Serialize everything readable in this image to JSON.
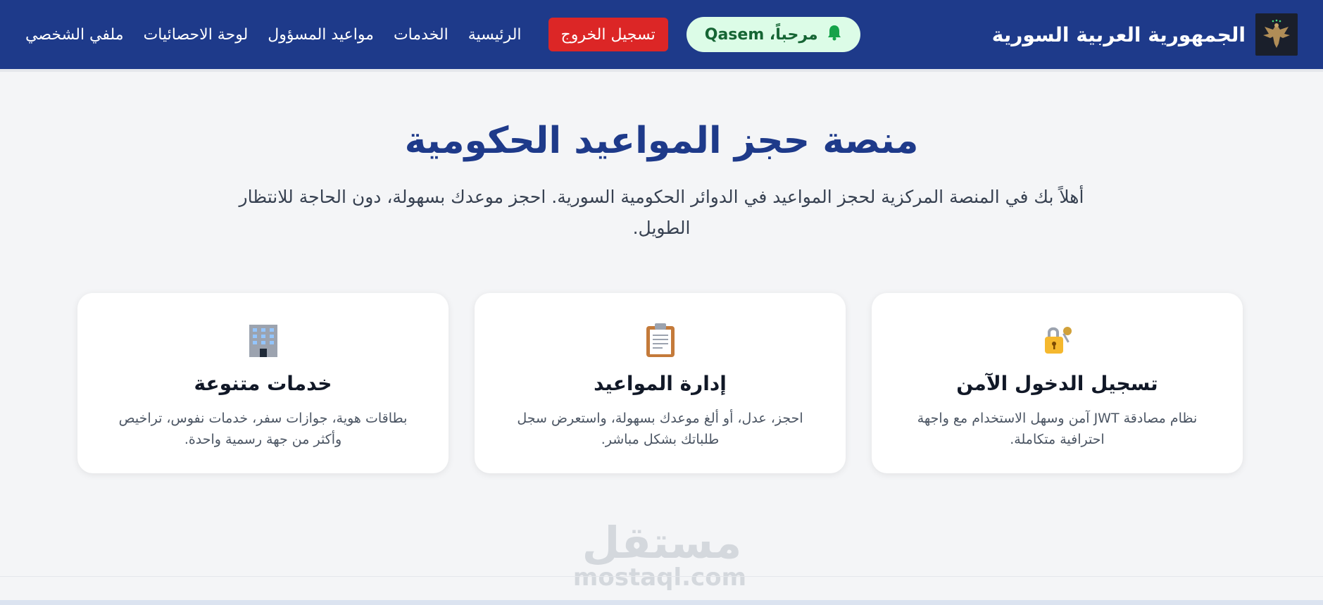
{
  "header": {
    "brand_title": "الجمهورية العربية السورية",
    "emblem_icon": "eagle-emblem-icon",
    "welcome_text": "مرحباً، Qasem",
    "bell_icon": "bell-icon",
    "logout_label": "تسجيل الخروج",
    "nav": [
      {
        "label": "الرئيسية"
      },
      {
        "label": "الخدمات"
      },
      {
        "label": "مواعيد المسؤول"
      },
      {
        "label": "لوحة الاحصائيات"
      },
      {
        "label": "ملفي الشخصي"
      }
    ],
    "colors": {
      "nav_bg": "#1e3a8a",
      "logout_bg": "#dc2626",
      "welcome_bg": "#dcfce7",
      "welcome_fg": "#166534"
    }
  },
  "hero": {
    "title": "منصة حجز المواعيد الحكومية",
    "subtitle": "أهلاً بك في المنصة المركزية لحجز المواعيد في الدوائر الحكومية السورية. احجز موعدك بسهولة، دون الحاجة للانتظار الطويل."
  },
  "cards": [
    {
      "icon": "lock-key-icon",
      "title": "تسجيل الدخول الآمن",
      "text": "نظام مصادقة JWT آمن وسهل الاستخدام مع واجهة احترافية متكاملة."
    },
    {
      "icon": "clipboard-icon",
      "title": "إدارة المواعيد",
      "text": "احجز، عدل، أو ألغ موعدك بسهولة، واستعرض سجل طلباتك بشكل مباشر."
    },
    {
      "icon": "office-building-icon",
      "title": "خدمات متنوعة",
      "text": "بطاقات هوية، جوازات سفر، خدمات نفوس، تراخيص وأكثر من جهة رسمية واحدة."
    }
  ],
  "watermark": {
    "ar": "مستقل",
    "en": "mostaql.com"
  }
}
